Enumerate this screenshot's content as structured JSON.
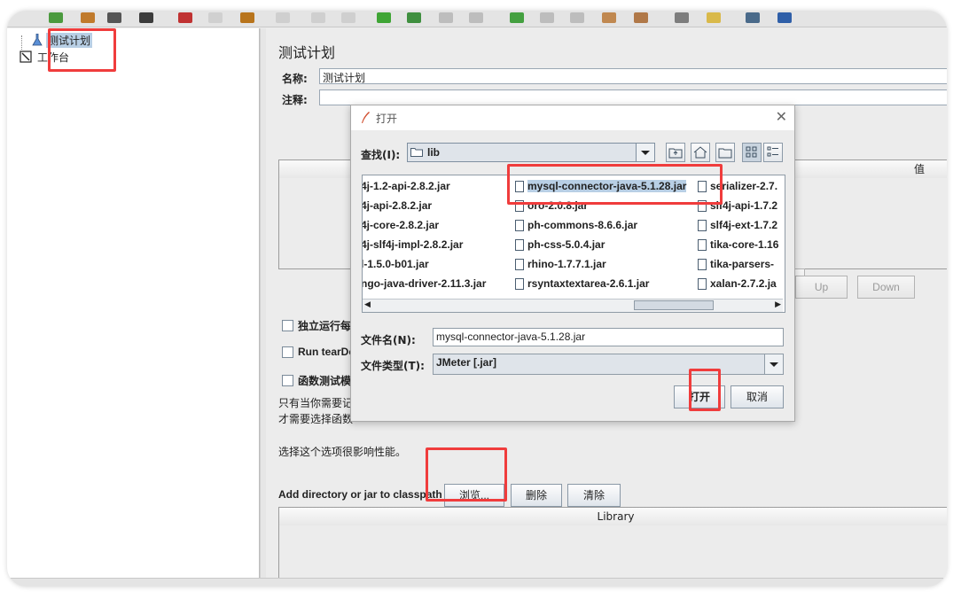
{
  "tree": {
    "items": [
      {
        "label": "测试计划",
        "icon": "test-plan-icon",
        "selected": true
      },
      {
        "label": "工作台",
        "icon": "workbench-icon",
        "selected": false
      }
    ]
  },
  "test_plan": {
    "title": "测试计划",
    "name_label": "名称:",
    "name_value": "测试计划",
    "comment_label": "注释:",
    "comment_value": "",
    "variables_table": {
      "value_header": "值"
    },
    "buttons": {
      "up": "Up",
      "down": "Down"
    },
    "checkboxes": [
      {
        "label": "独立运行每",
        "checked": false
      },
      {
        "label": "Run tearDo",
        "checked": false
      },
      {
        "label": "函数测试模",
        "checked": false
      }
    ],
    "hint_line1": "只有当你需要记",
    "hint_line2": "才需要选择函数",
    "perf_note": "选择这个选项很影响性能。",
    "classpath": {
      "label": "Add directory or jar to classpath",
      "browse": "浏览...",
      "delete": "删除",
      "clear": "清除",
      "library_header": "Library"
    }
  },
  "dialog": {
    "title": "打开",
    "look_in_label": "查找(I):",
    "look_in_value": "lib",
    "files": [
      {
        "name": "4j-1.2-api-2.8.2.jar",
        "col": 0,
        "row": 0
      },
      {
        "name": "4j-api-2.8.2.jar",
        "col": 0,
        "row": 1
      },
      {
        "name": "4j-core-2.8.2.jar",
        "col": 0,
        "row": 2
      },
      {
        "name": "4j-slf4j-impl-2.8.2.jar",
        "col": 0,
        "row": 3
      },
      {
        "name": "l-1.5.0-b01.jar",
        "col": 0,
        "row": 4
      },
      {
        "name": "ngo-java-driver-2.11.3.jar",
        "col": 0,
        "row": 5
      },
      {
        "name": "mysql-connector-java-5.1.28.jar",
        "col": 1,
        "row": 0,
        "selected": true
      },
      {
        "name": "oro-2.0.8.jar",
        "col": 1,
        "row": 1
      },
      {
        "name": "ph-commons-8.6.6.jar",
        "col": 1,
        "row": 2
      },
      {
        "name": "ph-css-5.0.4.jar",
        "col": 1,
        "row": 3
      },
      {
        "name": "rhino-1.7.7.1.jar",
        "col": 1,
        "row": 4
      },
      {
        "name": "rsyntaxtextarea-2.6.1.jar",
        "col": 1,
        "row": 5
      },
      {
        "name": "serializer-2.7.",
        "col": 2,
        "row": 0
      },
      {
        "name": "slf4j-api-1.7.2",
        "col": 2,
        "row": 1
      },
      {
        "name": "slf4j-ext-1.7.2",
        "col": 2,
        "row": 2
      },
      {
        "name": "tika-core-1.16",
        "col": 2,
        "row": 3
      },
      {
        "name": "tika-parsers-",
        "col": 2,
        "row": 4
      },
      {
        "name": "xalan-2.7.2.ja",
        "col": 2,
        "row": 5
      }
    ],
    "filename_label": "文件名(N):",
    "filename_value": "mysql-connector-java-5.1.28.jar",
    "filetype_label": "文件类型(T):",
    "filetype_value": "JMeter [.jar]",
    "open_button": "打开",
    "cancel_button": "取消"
  },
  "colors": {
    "highlight": "#f03c3c",
    "selection": "#b8cfe5"
  }
}
